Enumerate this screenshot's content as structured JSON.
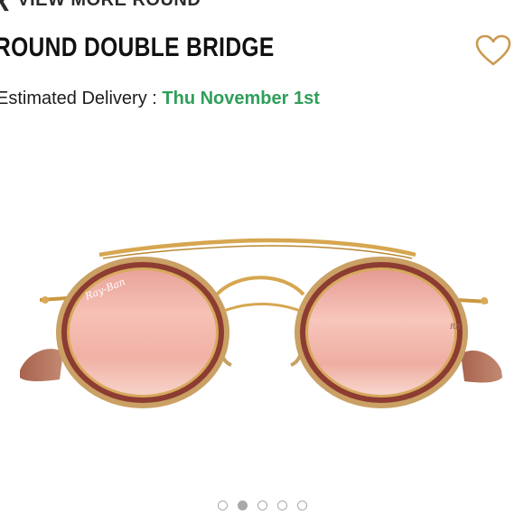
{
  "nav": {
    "back_label": "VIEW MORE ROUND"
  },
  "product": {
    "title": "ROUND DOUBLE BRIDGE",
    "delivery_label": "Estimated Delivery :",
    "delivery_date": "Thu November 1st",
    "image_alt": "Ray-Ban Round Double Bridge sunglasses with copper flash lenses",
    "lens_logo_left": "Ray-Ban",
    "lens_logo_right": "RB"
  },
  "colors": {
    "accent_green": "#2f9e5a",
    "frame_gold": "#d7a95d",
    "lens_copper": "#f4b6ad",
    "temple_brown": "#b3735c"
  },
  "icons": {
    "favorite": "heart-outline-icon",
    "back": "chevron-left-icon"
  },
  "carousel": {
    "total": 5,
    "active_index": 1
  }
}
